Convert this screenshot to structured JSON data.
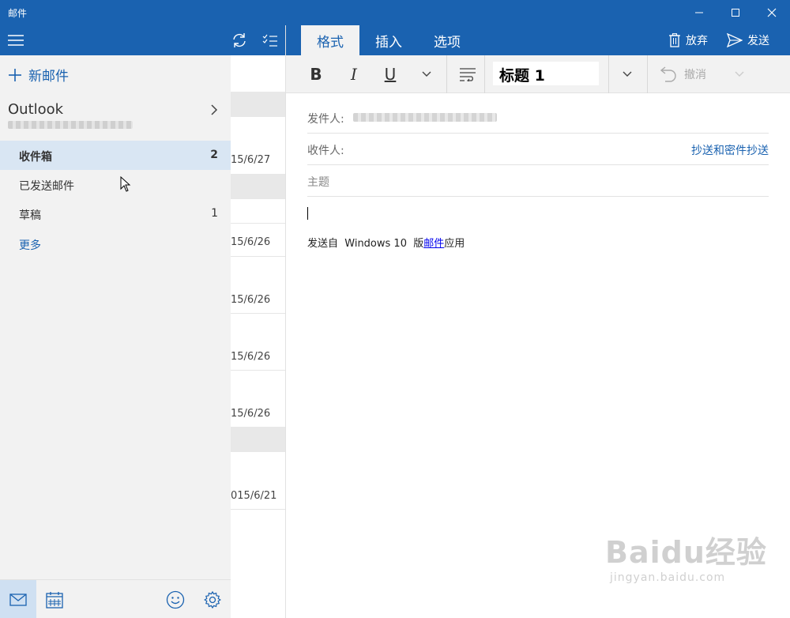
{
  "window": {
    "title": "邮件",
    "controls": [
      "minimize-icon",
      "maximize-icon",
      "close-icon"
    ]
  },
  "nav": {
    "new_mail": "新邮件",
    "account_name": "Outlook",
    "folders": [
      {
        "label": "收件箱",
        "count": "2",
        "active": true
      },
      {
        "label": "已发送邮件",
        "count": ""
      },
      {
        "label": "草稿",
        "count": "1"
      },
      {
        "label": "更多",
        "count": ""
      }
    ],
    "bottom_icons": [
      "mail-icon",
      "calendar-icon",
      "feedback-smiley-icon",
      "settings-gear-icon"
    ]
  },
  "message_list": {
    "toolbar_icons": [
      "sync-icon",
      "select-mode-icon"
    ],
    "dates": [
      "15/6/27",
      "15/6/26",
      "15/6/26",
      "15/6/26",
      "15/6/26",
      "015/6/21"
    ]
  },
  "compose": {
    "tabs": [
      {
        "label": "格式",
        "active": true
      },
      {
        "label": "插入"
      },
      {
        "label": "选项"
      }
    ],
    "discard": "放弃",
    "send": "发送",
    "format": {
      "bold": "B",
      "italic": "I",
      "underline": "U",
      "style": "标题 1",
      "undo": "撤消"
    },
    "from_label": "发件人:",
    "to_label": "收件人:",
    "cc_bcc": "抄送和密件抄送",
    "subject_placeholder": "主题",
    "signature_prefix": "发送自  Windows 10  版",
    "signature_link": "邮件",
    "signature_suffix": "应用"
  },
  "watermark": {
    "main": "Baidu经验",
    "sub": "jingyan.baidu.com"
  },
  "colors": {
    "accent": "#1a62b0",
    "nav_bg": "#f2f2f2",
    "selected_bg": "#d9e6f3"
  }
}
